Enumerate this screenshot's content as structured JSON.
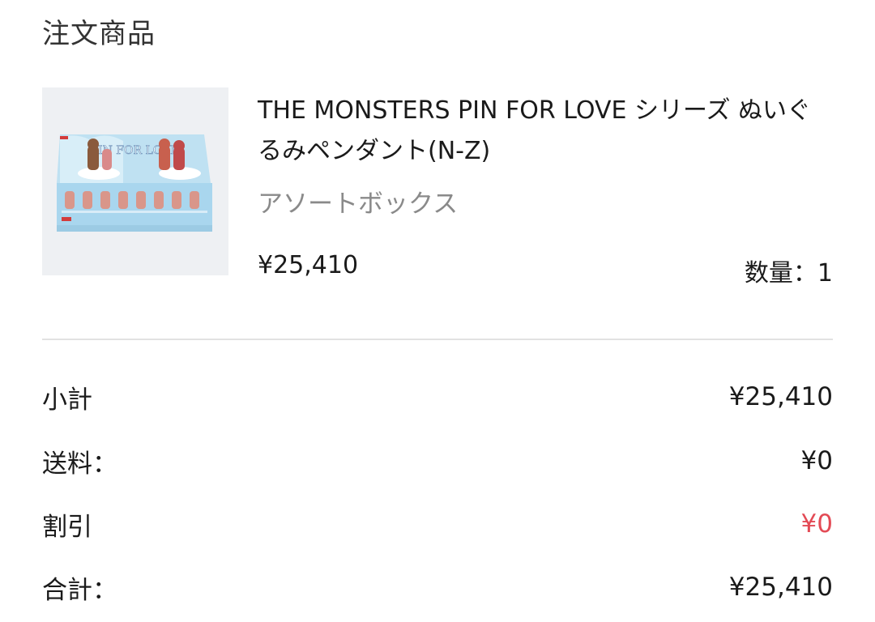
{
  "section": {
    "title": "注文商品"
  },
  "product": {
    "name": "THE MONSTERS PIN FOR LOVE シリーズ ぬいぐるみペンダント(N-Z)",
    "variant": "アソートボックス",
    "price": "¥25,410",
    "quantity_label": "数量：",
    "quantity": "1",
    "image_icon": "product-box-image",
    "image_text": "PIN FOR LOVE"
  },
  "summary": {
    "subtotal": {
      "label": "小計",
      "value": "¥25,410"
    },
    "shipping": {
      "label": "送料：",
      "value": "¥0"
    },
    "discount": {
      "label": "割引",
      "value": "¥0"
    },
    "total": {
      "label": "合計：",
      "value": "¥25,410"
    }
  },
  "colors": {
    "discount": "#e34a55",
    "muted_text": "#8a8a8a",
    "divider": "#e2e2e2",
    "image_bg": "#eef0f3"
  }
}
